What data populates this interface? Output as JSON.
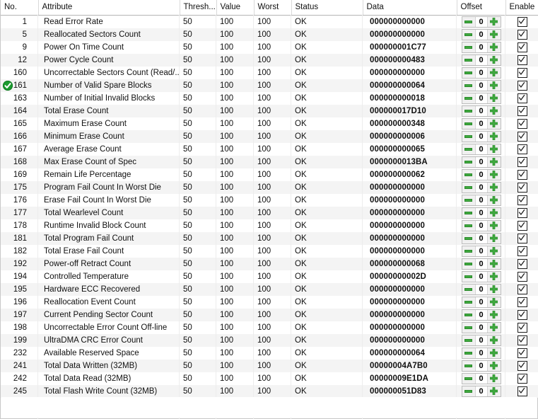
{
  "table": {
    "columns": [
      {
        "key": "no",
        "label": "No."
      },
      {
        "key": "attr",
        "label": "Attribute"
      },
      {
        "key": "thresh",
        "label": "Thresh..."
      },
      {
        "key": "value",
        "label": "Value"
      },
      {
        "key": "worst",
        "label": "Worst"
      },
      {
        "key": "status",
        "label": "Status"
      },
      {
        "key": "data",
        "label": "Data"
      },
      {
        "key": "offset",
        "label": "Offset"
      },
      {
        "key": "enable",
        "label": "Enable"
      }
    ],
    "offset_value": "0",
    "icons": {
      "status_ok": "check-circle-icon",
      "offset_decrement": "minus-icon",
      "offset_increment": "plus-icon",
      "enable_checkbox": "checkbox-checked-icon"
    },
    "colors": {
      "status_ok_green": "#1c9b2f",
      "spinner_green": "#3faa3f",
      "row_alt": "#f4f4f4",
      "grid_line": "#ededed",
      "header_underline": "#b4b4b4"
    },
    "rows": [
      {
        "no": "1",
        "attr": "Read Error Rate",
        "thresh": "50",
        "value": "100",
        "worst": "100",
        "status": "OK",
        "data": "000000000000",
        "offset": "0",
        "enable": true,
        "marked": false
      },
      {
        "no": "5",
        "attr": "Reallocated Sectors Count",
        "thresh": "50",
        "value": "100",
        "worst": "100",
        "status": "OK",
        "data": "000000000000",
        "offset": "0",
        "enable": true,
        "marked": false
      },
      {
        "no": "9",
        "attr": "Power On Time Count",
        "thresh": "50",
        "value": "100",
        "worst": "100",
        "status": "OK",
        "data": "000000001C77",
        "offset": "0",
        "enable": true,
        "marked": false
      },
      {
        "no": "12",
        "attr": "Power Cycle Count",
        "thresh": "50",
        "value": "100",
        "worst": "100",
        "status": "OK",
        "data": "000000000483",
        "offset": "0",
        "enable": true,
        "marked": false
      },
      {
        "no": "160",
        "attr": "Uncorrectable Sectors Count (Read/...",
        "thresh": "50",
        "value": "100",
        "worst": "100",
        "status": "OK",
        "data": "000000000000",
        "offset": "0",
        "enable": true,
        "marked": false
      },
      {
        "no": "161",
        "attr": "Number of Valid Spare Blocks",
        "thresh": "50",
        "value": "100",
        "worst": "100",
        "status": "OK",
        "data": "000000000064",
        "offset": "0",
        "enable": true,
        "marked": true
      },
      {
        "no": "163",
        "attr": "Number of Initial Invalid Blocks",
        "thresh": "50",
        "value": "100",
        "worst": "100",
        "status": "OK",
        "data": "000000000018",
        "offset": "0",
        "enable": true,
        "marked": false
      },
      {
        "no": "164",
        "attr": "Total Erase Count",
        "thresh": "50",
        "value": "100",
        "worst": "100",
        "status": "OK",
        "data": "000000017D10",
        "offset": "0",
        "enable": true,
        "marked": false
      },
      {
        "no": "165",
        "attr": "Maximum Erase Count",
        "thresh": "50",
        "value": "100",
        "worst": "100",
        "status": "OK",
        "data": "000000000348",
        "offset": "0",
        "enable": true,
        "marked": false
      },
      {
        "no": "166",
        "attr": "Minimum Erase Count",
        "thresh": "50",
        "value": "100",
        "worst": "100",
        "status": "OK",
        "data": "000000000006",
        "offset": "0",
        "enable": true,
        "marked": false
      },
      {
        "no": "167",
        "attr": "Average Erase Count",
        "thresh": "50",
        "value": "100",
        "worst": "100",
        "status": "OK",
        "data": "000000000065",
        "offset": "0",
        "enable": true,
        "marked": false
      },
      {
        "no": "168",
        "attr": "Max Erase Count of Spec",
        "thresh": "50",
        "value": "100",
        "worst": "100",
        "status": "OK",
        "data": "0000000013BA",
        "offset": "0",
        "enable": true,
        "marked": false
      },
      {
        "no": "169",
        "attr": "Remain Life Percentage",
        "thresh": "50",
        "value": "100",
        "worst": "100",
        "status": "OK",
        "data": "000000000062",
        "offset": "0",
        "enable": true,
        "marked": false
      },
      {
        "no": "175",
        "attr": "Program Fail Count In Worst Die",
        "thresh": "50",
        "value": "100",
        "worst": "100",
        "status": "OK",
        "data": "000000000000",
        "offset": "0",
        "enable": true,
        "marked": false
      },
      {
        "no": "176",
        "attr": "Erase Fail Count In Worst Die",
        "thresh": "50",
        "value": "100",
        "worst": "100",
        "status": "OK",
        "data": "000000000000",
        "offset": "0",
        "enable": true,
        "marked": false
      },
      {
        "no": "177",
        "attr": "Total Wearlevel Count",
        "thresh": "50",
        "value": "100",
        "worst": "100",
        "status": "OK",
        "data": "000000000000",
        "offset": "0",
        "enable": true,
        "marked": false
      },
      {
        "no": "178",
        "attr": "Runtime Invalid Block Count",
        "thresh": "50",
        "value": "100",
        "worst": "100",
        "status": "OK",
        "data": "000000000000",
        "offset": "0",
        "enable": true,
        "marked": false
      },
      {
        "no": "181",
        "attr": "Total Program Fail Count",
        "thresh": "50",
        "value": "100",
        "worst": "100",
        "status": "OK",
        "data": "000000000000",
        "offset": "0",
        "enable": true,
        "marked": false
      },
      {
        "no": "182",
        "attr": "Total Erase Fail Count",
        "thresh": "50",
        "value": "100",
        "worst": "100",
        "status": "OK",
        "data": "000000000000",
        "offset": "0",
        "enable": true,
        "marked": false
      },
      {
        "no": "192",
        "attr": "Power-off Retract Count",
        "thresh": "50",
        "value": "100",
        "worst": "100",
        "status": "OK",
        "data": "000000000068",
        "offset": "0",
        "enable": true,
        "marked": false
      },
      {
        "no": "194",
        "attr": "Controlled Temperature",
        "thresh": "50",
        "value": "100",
        "worst": "100",
        "status": "OK",
        "data": "00000000002D",
        "offset": "0",
        "enable": true,
        "marked": false
      },
      {
        "no": "195",
        "attr": "Hardware ECC Recovered",
        "thresh": "50",
        "value": "100",
        "worst": "100",
        "status": "OK",
        "data": "000000000000",
        "offset": "0",
        "enable": true,
        "marked": false
      },
      {
        "no": "196",
        "attr": "Reallocation Event Count",
        "thresh": "50",
        "value": "100",
        "worst": "100",
        "status": "OK",
        "data": "000000000000",
        "offset": "0",
        "enable": true,
        "marked": false
      },
      {
        "no": "197",
        "attr": "Current Pending Sector Count",
        "thresh": "50",
        "value": "100",
        "worst": "100",
        "status": "OK",
        "data": "000000000000",
        "offset": "0",
        "enable": true,
        "marked": false
      },
      {
        "no": "198",
        "attr": "Uncorrectable Error Count Off-line",
        "thresh": "50",
        "value": "100",
        "worst": "100",
        "status": "OK",
        "data": "000000000000",
        "offset": "0",
        "enable": true,
        "marked": false
      },
      {
        "no": "199",
        "attr": "UltraDMA CRC Error Count",
        "thresh": "50",
        "value": "100",
        "worst": "100",
        "status": "OK",
        "data": "000000000000",
        "offset": "0",
        "enable": true,
        "marked": false
      },
      {
        "no": "232",
        "attr": "Available Reserved Space",
        "thresh": "50",
        "value": "100",
        "worst": "100",
        "status": "OK",
        "data": "000000000064",
        "offset": "0",
        "enable": true,
        "marked": false
      },
      {
        "no": "241",
        "attr": "Total Data Written (32MB)",
        "thresh": "50",
        "value": "100",
        "worst": "100",
        "status": "OK",
        "data": "00000004A7B0",
        "offset": "0",
        "enable": true,
        "marked": false
      },
      {
        "no": "242",
        "attr": "Total Data Read (32MB)",
        "thresh": "50",
        "value": "100",
        "worst": "100",
        "status": "OK",
        "data": "00000009E1DA",
        "offset": "0",
        "enable": true,
        "marked": false
      },
      {
        "no": "245",
        "attr": "Total Flash Write Count (32MB)",
        "thresh": "50",
        "value": "100",
        "worst": "100",
        "status": "OK",
        "data": "000000051D83",
        "offset": "0",
        "enable": true,
        "marked": false
      }
    ]
  }
}
